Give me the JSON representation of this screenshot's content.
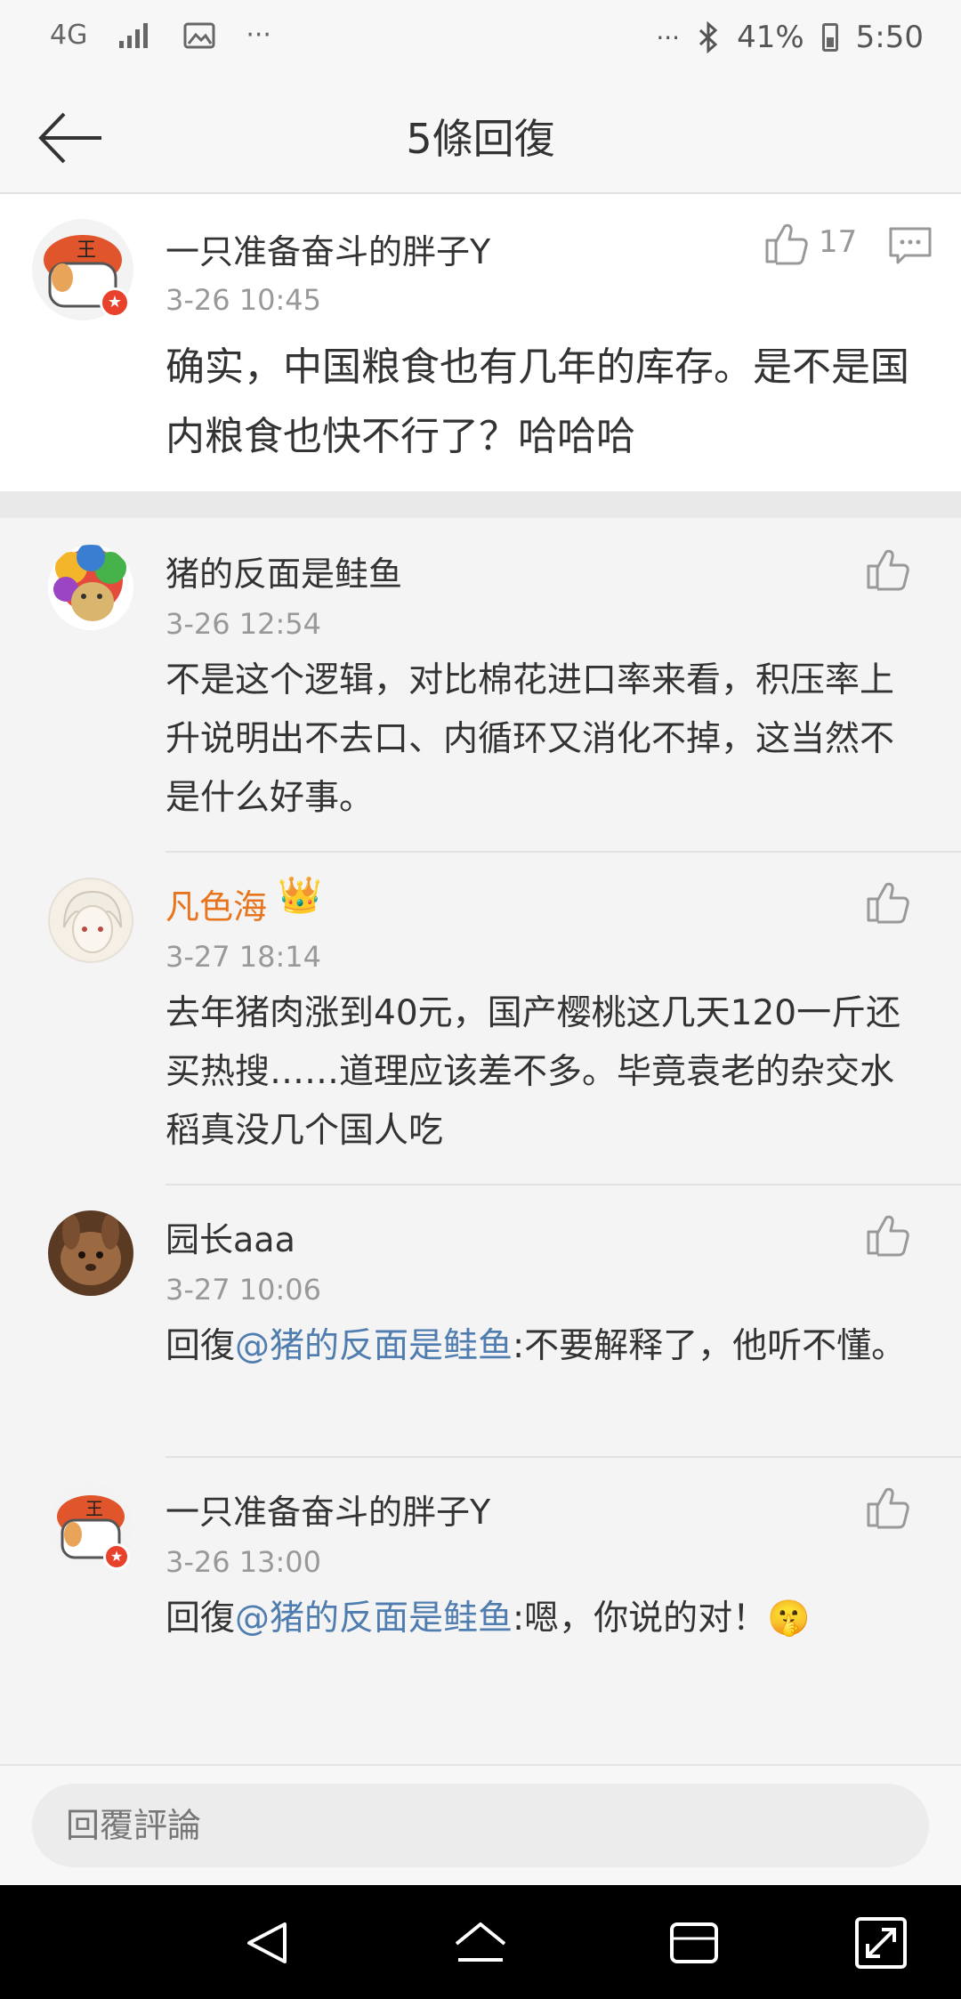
{
  "status_bar": {
    "network": "4G",
    "battery_percent": "41%",
    "time": "5:50",
    "icons": [
      "signal-icon",
      "image-icon",
      "more-icon",
      "bluetooth-icon",
      "battery-icon"
    ]
  },
  "header": {
    "title": "5條回復"
  },
  "main_comment": {
    "author": "一只准备奋斗的胖子Y",
    "time": "3-26 10:45",
    "text": "确实，中国粮食也有几年的库存。是不是国内粮食也快不行了？哈哈哈",
    "like_count": "17"
  },
  "replies": [
    {
      "author": "猪的反面是鲑鱼",
      "time": "3-26 12:54",
      "text": "不是这个逻辑，对比棉花进口率来看，积压率上升说明出不去口、内循环又消化不掉，这当然不是什么好事。"
    },
    {
      "author": "凡色海",
      "author_color": "#e8741e",
      "time": "3-27 18:14",
      "text": "去年猪肉涨到40元，国产樱桃这几天120一斤还买热搜……道理应该差不多。毕竟袁老的杂交水稻真没几个国人吃"
    },
    {
      "author": "园长aaa",
      "time": "3-27 10:06",
      "prefix": "回復",
      "mention": "@猪的反面是鲑鱼",
      "text": ":不要解释了，他听不懂。"
    },
    {
      "author": "一只准备奋斗的胖子Y",
      "time": "3-26 13:00",
      "prefix": "回復",
      "mention": "@猪的反面是鲑鱼",
      "text": ":嗯，你说的对！",
      "emoji": "🤫"
    }
  ],
  "input": {
    "placeholder": "回覆評論"
  },
  "colors": {
    "mention": "#507daf",
    "vip_name": "#e8741e",
    "badge": "#e8412c"
  }
}
